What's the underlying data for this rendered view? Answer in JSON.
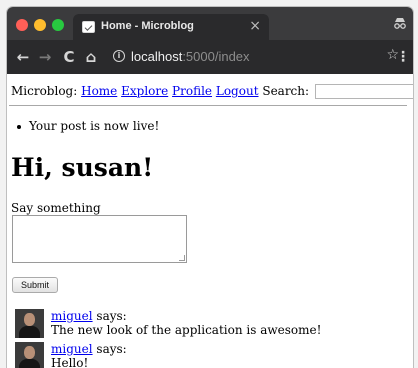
{
  "browser": {
    "tab_title": "Home - Microblog",
    "tab_close": "×",
    "url_host": "localhost",
    "url_rest": ":5000/index"
  },
  "page": {
    "navbar": {
      "brand": "Microblog:",
      "links": [
        "Home",
        "Explore",
        "Profile",
        "Logout"
      ],
      "search_label": "Search:",
      "search_value": ""
    },
    "flash": "Your post is now live!",
    "greeting": "Hi, susan!",
    "form": {
      "label": "Say something",
      "post_value": "",
      "submit_label": "Submit"
    },
    "posts": [
      {
        "author": "miguel",
        "says": "says:",
        "body": "The new look of the application is awesome!"
      },
      {
        "author": "miguel",
        "says": "says:",
        "body": "Hello!"
      }
    ]
  }
}
